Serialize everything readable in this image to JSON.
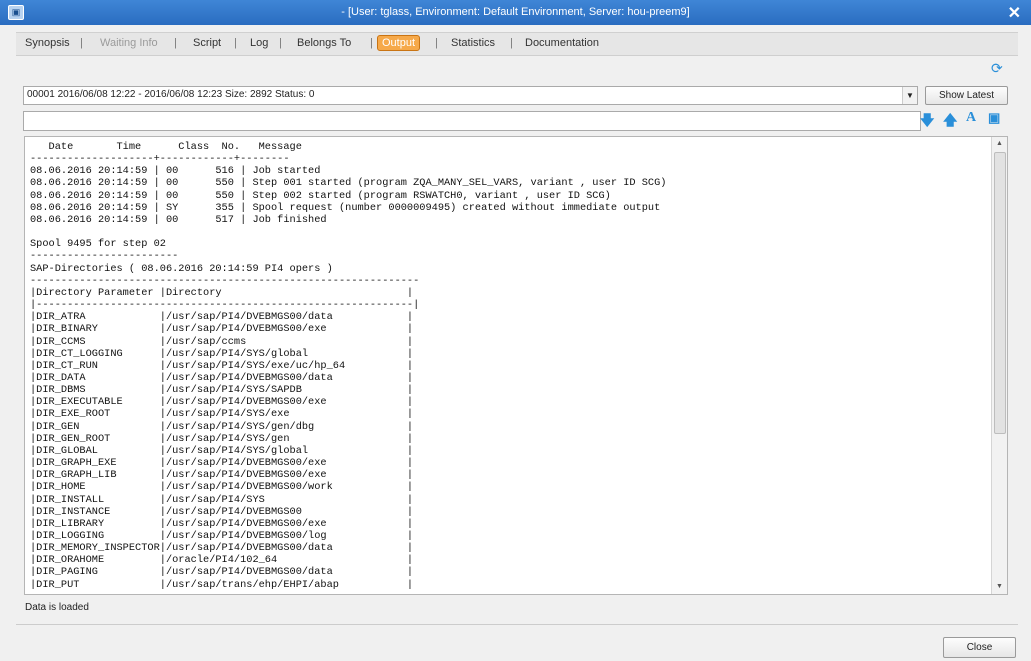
{
  "window": {
    "title": "- [User: tglass, Environment: Default Environment, Server: hou-preem9]",
    "app_icon": "app-window-icon",
    "close_glyph": "✕"
  },
  "tabs": [
    {
      "label": "Synopsis",
      "state": "normal"
    },
    {
      "label": "Waiting Info",
      "state": "disabled"
    },
    {
      "label": "Script",
      "state": "normal"
    },
    {
      "label": "Log",
      "state": "normal"
    },
    {
      "label": "Belongs To",
      "state": "normal"
    },
    {
      "label": "Output",
      "state": "active"
    },
    {
      "label": "Statistics",
      "state": "normal"
    },
    {
      "label": "Documentation",
      "state": "normal"
    }
  ],
  "output_selector": {
    "selected": "00001 2016/06/08 12:22 - 2016/06/08 12:23 Size: 2892 Status: 0"
  },
  "buttons": {
    "show_latest": "Show Latest",
    "close": "Close"
  },
  "search": {
    "value": ""
  },
  "icons": {
    "refresh": "refresh-icon",
    "arrow_down": "arrow-down-icon",
    "arrow_up": "arrow-up-icon",
    "font": "font-icon",
    "save": "save-icon"
  },
  "output_text": "   Date       Time      Class  No.   Message\n--------------------+------------+--------\n08.06.2016 20:14:59 | 00      516 | Job started\n08.06.2016 20:14:59 | 00      550 | Step 001 started (program ZQA_MANY_SEL_VARS, variant , user ID SCG)\n08.06.2016 20:14:59 | 00      550 | Step 002 started (program RSWATCH0, variant , user ID SCG)\n08.06.2016 20:14:59 | SY      355 | Spool request (number 0000009495) created without immediate output\n08.06.2016 20:14:59 | 00      517 | Job finished\n\nSpool 9495 for step 02\n------------------------\nSAP-Directories ( 08.06.2016 20:14:59 PI4 opers )\n---------------------------------------------------------------\n|Directory Parameter |Directory                              |\n|-------------------------------------------------------------|\n|DIR_ATRA            |/usr/sap/PI4/DVEBMGS00/data            |\n|DIR_BINARY          |/usr/sap/PI4/DVEBMGS00/exe             |\n|DIR_CCMS            |/usr/sap/ccms                          |\n|DIR_CT_LOGGING      |/usr/sap/PI4/SYS/global                |\n|DIR_CT_RUN          |/usr/sap/PI4/SYS/exe/uc/hp_64          |\n|DIR_DATA            |/usr/sap/PI4/DVEBMGS00/data            |\n|DIR_DBMS            |/usr/sap/PI4/SYS/SAPDB                 |\n|DIR_EXECUTABLE      |/usr/sap/PI4/DVEBMGS00/exe             |\n|DIR_EXE_ROOT        |/usr/sap/PI4/SYS/exe                   |\n|DIR_GEN             |/usr/sap/PI4/SYS/gen/dbg               |\n|DIR_GEN_ROOT        |/usr/sap/PI4/SYS/gen                   |\n|DIR_GLOBAL          |/usr/sap/PI4/SYS/global                |\n|DIR_GRAPH_EXE       |/usr/sap/PI4/DVEBMGS00/exe             |\n|DIR_GRAPH_LIB       |/usr/sap/PI4/DVEBMGS00/exe             |\n|DIR_HOME            |/usr/sap/PI4/DVEBMGS00/work            |\n|DIR_INSTALL         |/usr/sap/PI4/SYS                       |\n|DIR_INSTANCE        |/usr/sap/PI4/DVEBMGS00                 |\n|DIR_LIBRARY         |/usr/sap/PI4/DVEBMGS00/exe             |\n|DIR_LOGGING         |/usr/sap/PI4/DVEBMGS00/log             |\n|DIR_MEMORY_INSPECTOR|/usr/sap/PI4/DVEBMGS00/data            |\n|DIR_ORAHOME         |/oracle/PI4/102_64                     |\n|DIR_PAGING          |/usr/sap/PI4/DVEBMGS00/data            |\n|DIR_PUT             |/usr/sap/trans/ehp/EHPI/abap           |",
  "status": "Data is loaded"
}
